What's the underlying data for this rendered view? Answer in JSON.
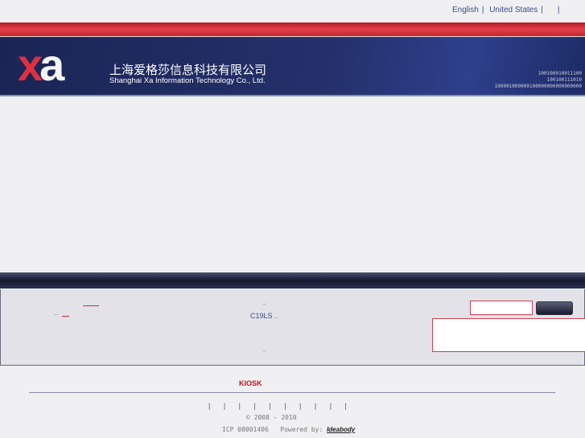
{
  "top_links": [
    "English",
    "United States"
  ],
  "header": {
    "logo": "xa",
    "company_cn": "上海爱格莎信息科技有限公司",
    "company_en": "Shanghai Xa Information Technology Co., Ltd.",
    "binary": [
      "100100010011100",
      "100100111010",
      "100001000000100000000000000000"
    ]
  },
  "panel": {
    "product": "C19LS",
    "ellipsis": "..."
  },
  "footer": {
    "kiosk": "KIOSK",
    "separators": "| | | | | | | | | |",
    "copyright": "© 2008 - 2010",
    "icp": "ICP 08001406",
    "powered_label": "Powered by:",
    "powered_link": "Ideabody"
  }
}
